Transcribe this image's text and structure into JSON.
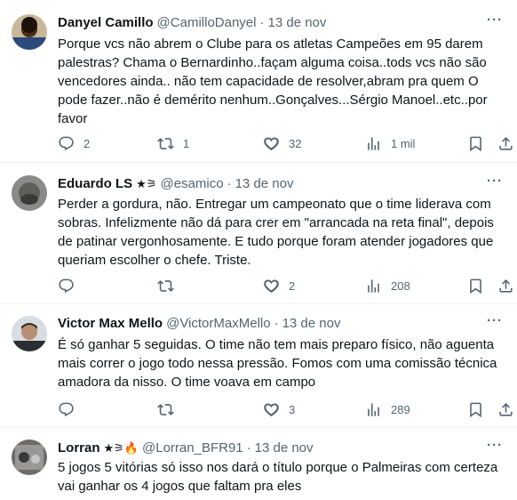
{
  "tweets": [
    {
      "name": "Danyel Camillo",
      "badge": "",
      "handle": "@CamilloDanyel",
      "dot": "·",
      "date": "13 de nov",
      "text": "Porque vcs não abrem o Clube para os atletas Campeões em 95 darem palestras? Chama o Bernardinho..façam alguma coisa..tods vcs não são vencedores ainda.. não tem capacidade de resolver,abram pra quem O pode fazer..não é demérito nenhum..Gonçalves...Sérgio Manoel..etc..por favor",
      "replies": "2",
      "retweets": "1",
      "likes": "32",
      "views": "1 mil"
    },
    {
      "name": "Eduardo LS",
      "badge": "★⚞",
      "handle": "@esamico",
      "dot": "·",
      "date": "13 de nov",
      "text": "Perder a gordura, não. Entregar um campeonato que o time liderava com sobras. Infelizmente não dá para crer em \"arrancada na reta final\", depois de patinar vergonhosamente. E tudo porque foram atender jogadores que queriam escolher o chefe. Triste.",
      "replies": "",
      "retweets": "",
      "likes": "2",
      "views": "208"
    },
    {
      "name": "Victor Max Mello",
      "badge": "",
      "handle": "@VictorMaxMello",
      "dot": "·",
      "date": "13 de nov",
      "text": "É só ganhar 5 seguidas. O time não tem mais preparo físico, não aguenta mais correr o jogo todo nessa pressão. Fomos com uma comissão técnica amadora da nisso. O time voava em campo",
      "replies": "",
      "retweets": "",
      "likes": "3",
      "views": "289"
    },
    {
      "name": "Lorran",
      "badge": "★⚞🔥",
      "handle": "@Lorran_BFR91",
      "dot": "·",
      "date": "13 de nov",
      "text": "5 jogos 5 vitórias só isso nos dará o título porque o Palmeiras com certeza vai ganhar os 4 jogos que faltam pra eles"
    }
  ],
  "more_label": "···",
  "icons": {
    "reply": "reply-icon",
    "retweet": "retweet-icon",
    "like": "heart-icon",
    "views": "views-icon",
    "bookmark": "bookmark-icon",
    "share": "share-icon"
  },
  "colors": {
    "text": "#0f1419",
    "secondary": "#536471",
    "divider": "#eff3f4"
  }
}
